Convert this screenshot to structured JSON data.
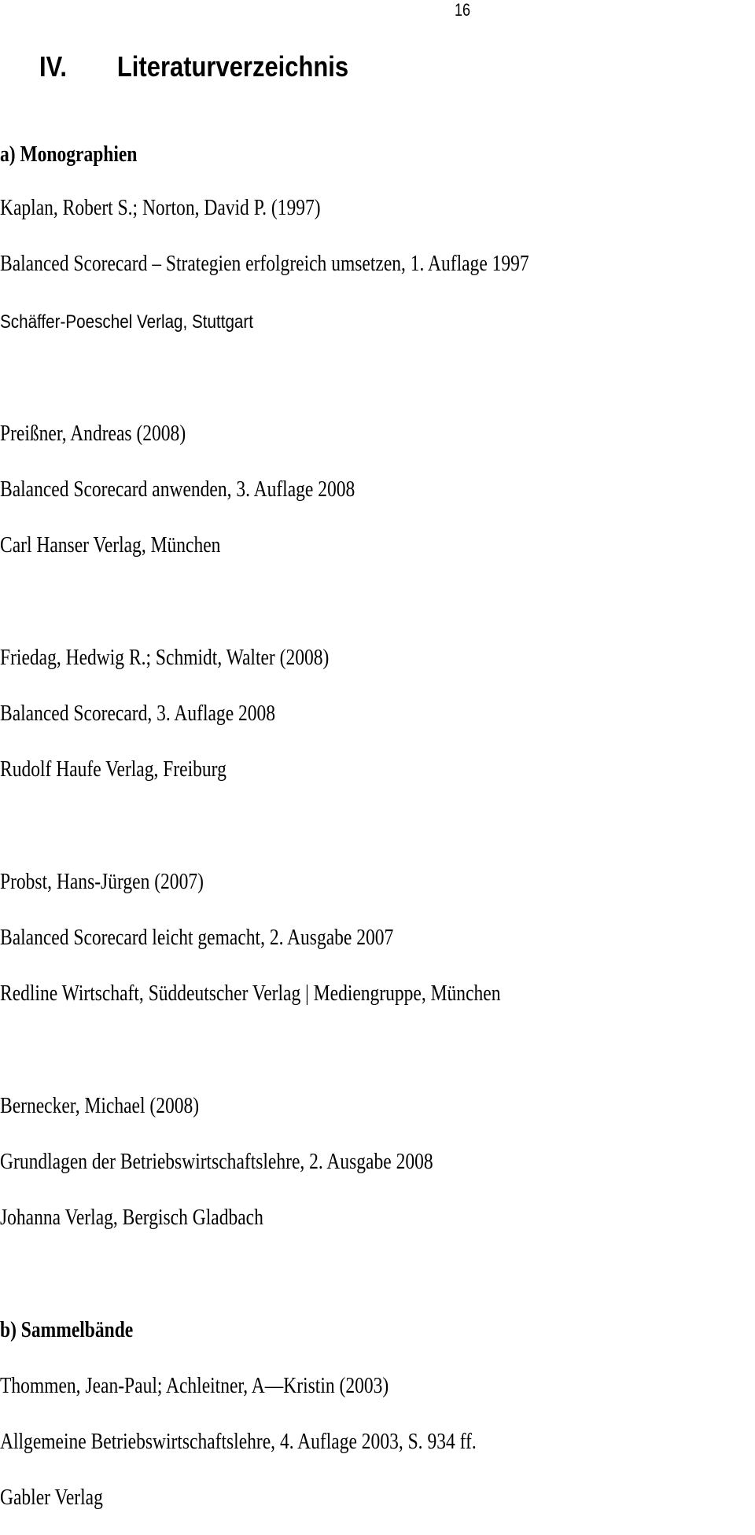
{
  "page": {
    "number": "16"
  },
  "chapter": {
    "numeral": "IV.",
    "title": "Literaturverzeichnis"
  },
  "sections": [
    {
      "heading": "a) Monographien",
      "entries": [
        {
          "authors": "Kaplan, Robert S.; Norton, David P. (1997)",
          "title": "Balanced Scorecard – Strategien erfolgreich umsetzen, 1. Auflage 1997",
          "publisher": "Schäffer-Poeschel Verlag, Stuttgart"
        },
        {
          "authors": "Preißner, Andreas (2008)",
          "title": "Balanced Scorecard anwenden, 3. Auflage 2008",
          "publisher": "Carl Hanser Verlag, München"
        },
        {
          "authors": "Friedag, Hedwig R.; Schmidt, Walter (2008)",
          "title": "Balanced Scorecard, 3. Auflage 2008",
          "publisher": "Rudolf Haufe Verlag, Freiburg"
        },
        {
          "authors": "Probst, Hans-Jürgen (2007)",
          "title": "Balanced Scorecard leicht gemacht, 2. Ausgabe 2007",
          "publisher": "Redline Wirtschaft, Süddeutscher Verlag | Mediengruppe, München"
        },
        {
          "authors": "Bernecker, Michael (2008)",
          "title": "Grundlagen der Betriebswirtschaftslehre, 2. Ausgabe 2008",
          "publisher": "Johanna Verlag, Bergisch Gladbach"
        }
      ]
    },
    {
      "heading": "b) Sammelbände",
      "entries": [
        {
          "authors": "Thommen, Jean-Paul; Achleitner, A—Kristin (2003)",
          "title": "Allgemeine Betriebswirtschaftslehre, 4. Auflage 2003, S. 934 ff.",
          "publisher": "Gabler Verlag"
        }
      ]
    }
  ]
}
